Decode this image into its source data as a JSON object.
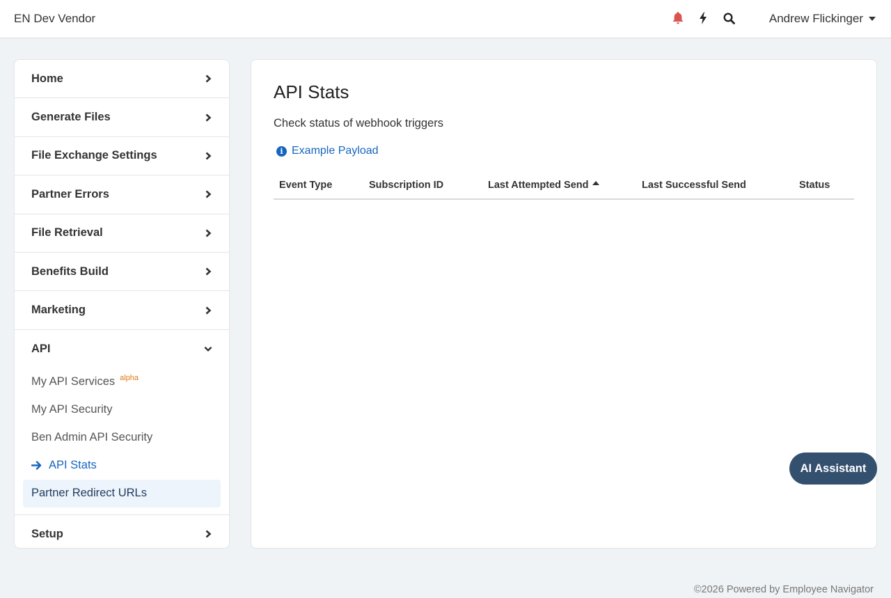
{
  "header": {
    "brand": "EN Dev Vendor",
    "user_name": "Andrew Flickinger",
    "icons": [
      "bell-icon",
      "bolt-icon",
      "search-icon"
    ],
    "bell_color": "#d9534f"
  },
  "sidebar": {
    "items_top": [
      {
        "label": "Home"
      },
      {
        "label": "Generate Files"
      },
      {
        "label": "File Exchange Settings"
      },
      {
        "label": "Partner Errors"
      },
      {
        "label": "File Retrieval"
      },
      {
        "label": "Benefits Build"
      },
      {
        "label": "Marketing"
      }
    ],
    "api": {
      "label": "API",
      "sub_items": [
        {
          "label": "My API Services",
          "badge": "alpha"
        },
        {
          "label": "My API Security"
        },
        {
          "label": "Ben Admin API Security"
        },
        {
          "label": "API Stats",
          "active": true
        },
        {
          "label": "Partner Redirect URLs"
        }
      ]
    },
    "items_bottom": [
      {
        "label": "Setup"
      }
    ]
  },
  "main": {
    "title": "API Stats",
    "subtitle": "Check status of webhook triggers",
    "payload_link": "Example Payload",
    "table": {
      "columns": [
        "Event Type",
        "Subscription ID",
        "Last Attempted Send",
        "Last Successful Send",
        "Status"
      ],
      "sorted_column": "Last Attempted Send",
      "sort_direction": "ascending",
      "rows": []
    }
  },
  "ai_button": "AI Assistant",
  "footer": "©2026 Powered by Employee Navigator",
  "colors": {
    "accent": "#1565c0",
    "ai_button_bg": "#34506f",
    "badge": "#e07a1a"
  }
}
